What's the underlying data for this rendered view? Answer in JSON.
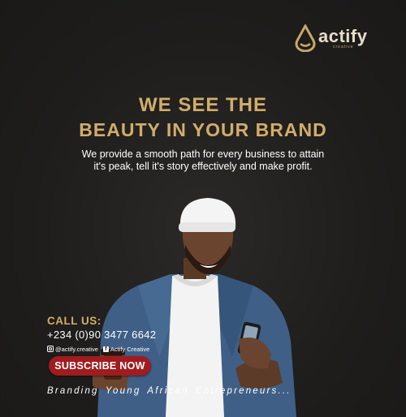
{
  "brand": {
    "name": "actify",
    "sub": "creative"
  },
  "headline": {
    "line1": "WE SEE THE",
    "line2": "BEAUTY IN YOUR BRAND"
  },
  "subtext": {
    "line1": "We provide a smooth path for every business to attain",
    "line2": "it's peak, tell it's story effectively and make profit."
  },
  "contact": {
    "call_label": "CALL US:",
    "phone": "+234 (0)90 3477 6642",
    "instagram_handle": "@actify.creative",
    "facebook_page": "Actify Creative"
  },
  "cta": {
    "subscribe_label": "SUBSCRIBE NOW"
  },
  "tagline": "Branding  Young  African  Entrepreneurs...",
  "colors": {
    "background": "#1f1e1d",
    "gold": "#d2ad6a",
    "button_red": "#a01c1f",
    "text": "#ffffff"
  }
}
